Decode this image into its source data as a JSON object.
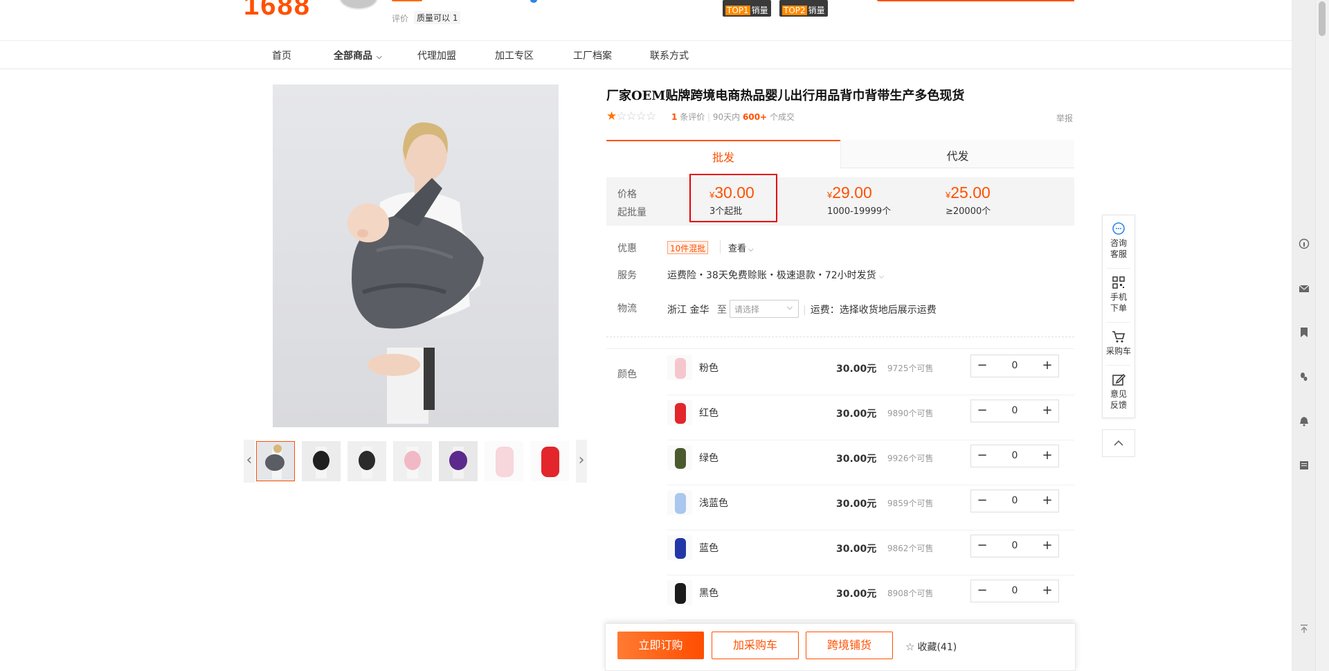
{
  "header": {
    "logo": "1688",
    "rating_label": "评价",
    "rating_value": "质量可以 1",
    "rank_badges": [
      {
        "tag": "TOP1",
        "text": "销量"
      },
      {
        "tag": "TOP2",
        "text": "销量"
      }
    ]
  },
  "nav": {
    "items": [
      "首页",
      "全部商品",
      "代理加盟",
      "加工专区",
      "工厂档案",
      "联系方式"
    ]
  },
  "product": {
    "title": "厂家OEM贴牌跨境电商热品婴儿出行用品背巾背带生产多色现货",
    "rating_stars": 1,
    "review_count": "1",
    "review_suffix": "条评价",
    "sold_prefix": "90天内",
    "sold_count": "600+",
    "sold_suffix": "个成交",
    "report": "举报"
  },
  "tabs": {
    "wholesale": "批发",
    "dropship": "代发"
  },
  "pricing": {
    "price_label": "价格",
    "moq_label": "起批量",
    "currency": "¥",
    "tiers": [
      {
        "price": "30.00",
        "qty": "3个起批"
      },
      {
        "price": "29.00",
        "qty": "1000-19999个"
      },
      {
        "price": "25.00",
        "qty": "≥20000个"
      }
    ]
  },
  "promo": {
    "label": "优惠",
    "tag": "10件混批",
    "view": "查看"
  },
  "service": {
    "label": "服务",
    "text": "运费险・38天免费赊账・极速退款・72小时发货"
  },
  "logistics": {
    "label": "物流",
    "from": "浙江 金华",
    "to": "至",
    "select_placeholder": "请选择",
    "fee": "运费：选择收货地后展示运费"
  },
  "sku": {
    "label": "颜色",
    "items": [
      {
        "name": "粉色",
        "price": "30.00元",
        "stock": "9725个可售",
        "qty": "0",
        "color": "#f6c6cf"
      },
      {
        "name": "红色",
        "price": "30.00元",
        "stock": "9890个可售",
        "qty": "0",
        "color": "#e2262b"
      },
      {
        "name": "绿色",
        "price": "30.00元",
        "stock": "9926个可售",
        "qty": "0",
        "color": "#4a5a2e"
      },
      {
        "name": "浅蓝色",
        "price": "30.00元",
        "stock": "9859个可售",
        "qty": "0",
        "color": "#a9c7ef"
      },
      {
        "name": "蓝色",
        "price": "30.00元",
        "stock": "9862个可售",
        "qty": "0",
        "color": "#2336a8"
      },
      {
        "name": "黑色",
        "price": "30.00元",
        "stock": "8908个可售",
        "qty": "0",
        "color": "#1a1a1a"
      }
    ]
  },
  "actions": {
    "buy": "立即订购",
    "cart": "加采购车",
    "crossborder": "跨境铺货",
    "favorite": "收藏(41)"
  },
  "float_tools": {
    "consult": "咨询 客服",
    "mobile": "手机 下单",
    "cart": "采购车",
    "feedback": "意见 反馈"
  },
  "colors": {
    "accent": "#ff5000",
    "highlight_box": "#e60000"
  }
}
